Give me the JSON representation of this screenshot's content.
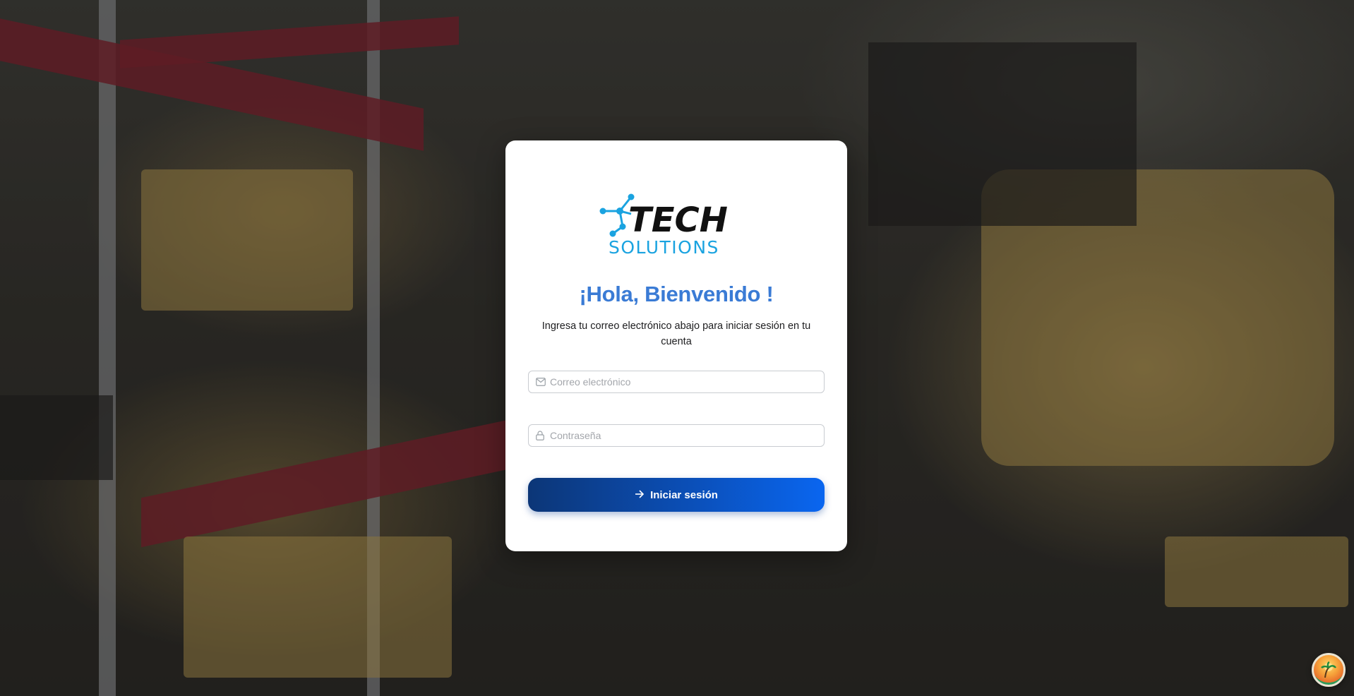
{
  "brand": {
    "logo_line1": "TECH",
    "logo_line2": "SOLUTIONS",
    "primary_color": "#3a7bd5",
    "accent_color": "#1aa3e0"
  },
  "login": {
    "title": "¡Hola, Bienvenido !",
    "subtitle": "Ingresa tu correo electrónico abajo para iniciar sesión en tu cuenta",
    "email_placeholder": "Correo electrónico",
    "email_value": "",
    "password_placeholder": "Contraseña",
    "password_value": "",
    "submit_label": "Iniciar sesión",
    "submit_icon": "arrow-right-icon"
  },
  "icons": {
    "email": "mail-icon",
    "password": "lock-icon",
    "floating": "beach-avatar-icon"
  }
}
